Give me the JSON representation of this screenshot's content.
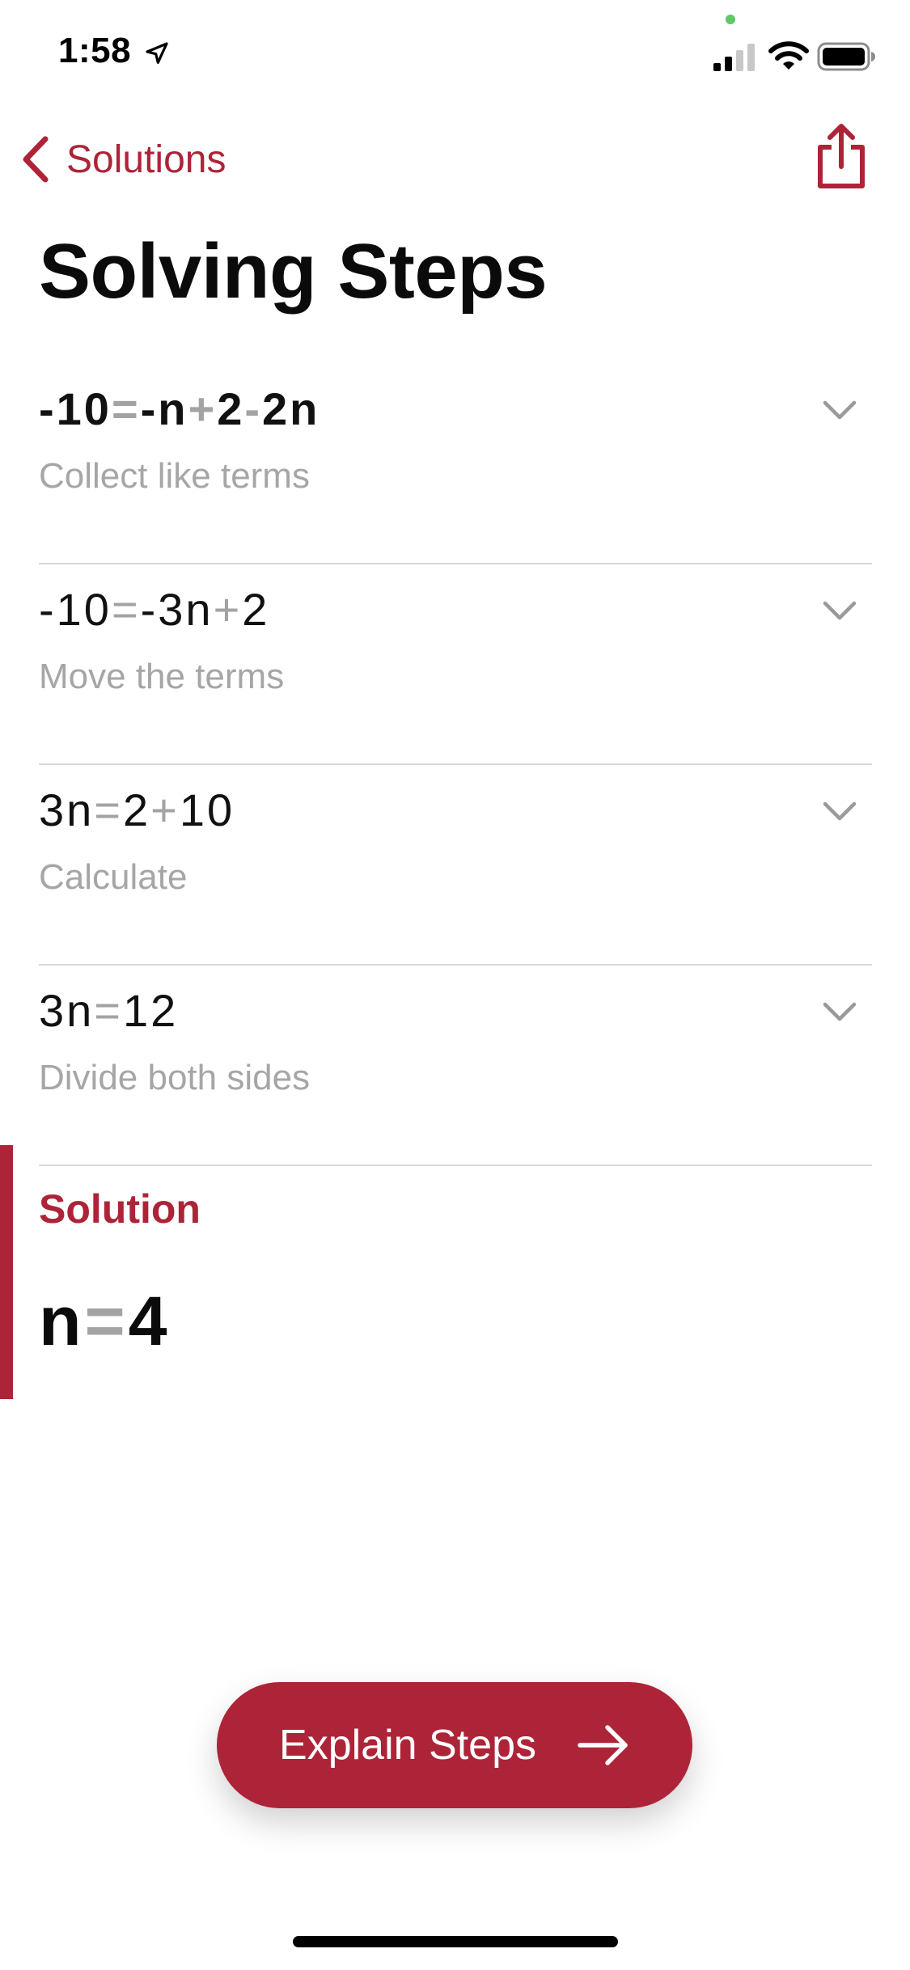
{
  "status_bar": {
    "time": "1:58",
    "icons": [
      "location-arrow-icon",
      "cellular-signal-icon",
      "wifi-icon",
      "battery-icon"
    ]
  },
  "nav": {
    "back_label": "Solutions",
    "back_icon": "chevron-left-icon",
    "share_icon": "share-icon"
  },
  "title": "Solving Steps",
  "steps": [
    {
      "equation": [
        "-10",
        "=",
        "-n",
        "+",
        "2",
        "-",
        "2n"
      ],
      "description": "Collect like terms"
    },
    {
      "equation": [
        "-10",
        "=",
        "-3n",
        "+",
        "2"
      ],
      "description": "Move the terms"
    },
    {
      "equation": [
        "3n",
        "=",
        "2",
        "+",
        "10"
      ],
      "description": "Calculate"
    },
    {
      "equation": [
        "3n",
        "=",
        "12"
      ],
      "description": "Divide both sides"
    }
  ],
  "solution": {
    "label": "Solution",
    "equation": [
      "n",
      "=",
      "4"
    ]
  },
  "explain_button": {
    "label": "Explain Steps",
    "icon": "arrow-right-icon"
  },
  "colors": {
    "accent": "#ad2438",
    "operator_gray": "#a3a3a3",
    "description_gray": "#a6a6a6",
    "divider": "#d8d8d8"
  }
}
